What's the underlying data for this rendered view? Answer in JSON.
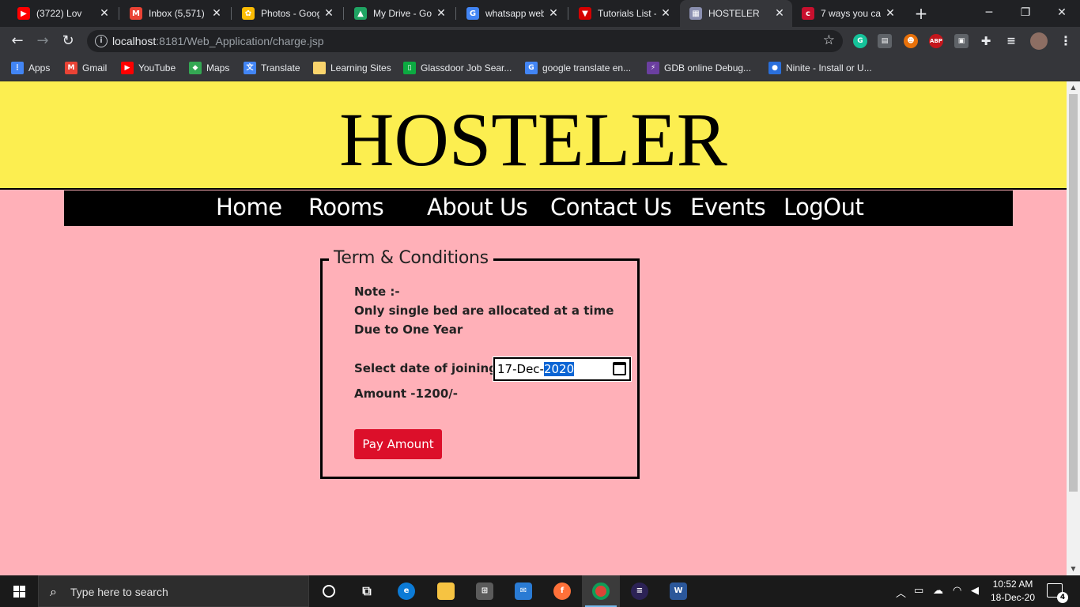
{
  "browser": {
    "tabs": [
      {
        "title": "(3722) Lov",
        "icon": "youtube-icon",
        "color": "#ff0000",
        "glyph": "▶"
      },
      {
        "title": "Inbox (5,571) -",
        "icon": "gmail-icon",
        "color": "#ea4335",
        "glyph": "M"
      },
      {
        "title": "Photos - Goog",
        "icon": "google-photos-icon",
        "color": "#fbbc04",
        "glyph": "✿"
      },
      {
        "title": "My Drive - Go",
        "icon": "google-drive-icon",
        "color": "#1fa463",
        "glyph": "▲"
      },
      {
        "title": "whatsapp web",
        "icon": "google-icon",
        "color": "#4285f4",
        "glyph": "G"
      },
      {
        "title": "Tutorials List -",
        "icon": "tutorials-icon",
        "color": "#d50000",
        "glyph": "▼"
      },
      {
        "title": "HOSTELER",
        "icon": "page-icon",
        "color": "#8a8fb0",
        "glyph": "▦"
      },
      {
        "title": "7 ways you ca",
        "icon": "cnet-icon",
        "color": "#c8102e",
        "glyph": "c"
      }
    ],
    "url_host": "localhost",
    "url_path": ":8181/Web_Application/charge.jsp",
    "bookmarks": [
      {
        "label": "Apps",
        "icon": "apps-grid-icon",
        "color": "#4285f4",
        "glyph": "⋮"
      },
      {
        "label": "Gmail",
        "icon": "gmail-icon",
        "color": "#ea4335",
        "glyph": "M"
      },
      {
        "label": "YouTube",
        "icon": "youtube-icon",
        "color": "#ff0000",
        "glyph": "▶"
      },
      {
        "label": "Maps",
        "icon": "maps-icon",
        "color": "#34a853",
        "glyph": "◆"
      },
      {
        "label": "Translate",
        "icon": "translate-icon",
        "color": "#4285f4",
        "glyph": "文"
      },
      {
        "label": "Learning Sites",
        "icon": "folder-icon",
        "color": "#f9d46c",
        "glyph": ""
      },
      {
        "label": "Glassdoor Job Sear...",
        "icon": "glassdoor-icon",
        "color": "#0caa41",
        "glyph": "▯"
      },
      {
        "label": "google translate en...",
        "icon": "google-icon",
        "color": "#4285f4",
        "glyph": "G"
      },
      {
        "label": "GDB online Debug...",
        "icon": "gdb-icon",
        "color": "#6b3fa0",
        "glyph": "⚡"
      },
      {
        "label": "Ninite - Install or U...",
        "icon": "ninite-icon",
        "color": "#2a6fdb",
        "glyph": "●"
      }
    ]
  },
  "page": {
    "site_title": "HOSTELER",
    "nav": [
      "Home",
      "Rooms",
      "About Us",
      "Contact Us",
      "Events",
      "LogOut"
    ],
    "form": {
      "legend": "Term & Conditions",
      "note_lines": [
        "Note :-",
        "Only single bed are allocated at a time",
        "Due to One Year"
      ],
      "join_label": "Select date of joining -",
      "date_day": "17",
      "date_month": "Dec",
      "date_year": "2020",
      "amount": "Amount -1200/-",
      "pay_button": "Pay Amount"
    }
  },
  "taskbar": {
    "search_placeholder": "Type here to search",
    "time": "10:52 AM",
    "date": "18-Dec-20",
    "notification_count": "4"
  }
}
